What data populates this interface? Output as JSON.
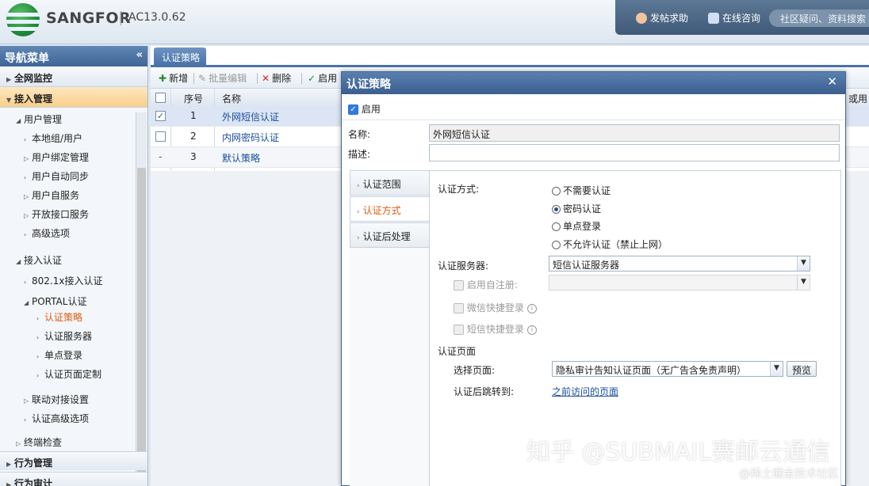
{
  "app": {
    "brand": "SANGFOR",
    "version": "AC13.0.62"
  },
  "topbar": {
    "help_label": "发帖求助",
    "consult_label": "在线咨询",
    "search_placeholder": "社区疑问、资料搜索"
  },
  "sidebar": {
    "title": "导航菜单",
    "collapse_glyph": "«",
    "sections": [
      "全网监控",
      "接入管理"
    ],
    "tree": {
      "user_mgmt": "用户管理",
      "user_items": [
        "本地组/用户",
        "用户绑定管理",
        "用户自动同步",
        "用户自服务",
        "开放接口服务",
        "高级选项"
      ],
      "access_auth": "接入认证",
      "access_items": [
        "802.1x接入认证",
        "PORTAL认证"
      ],
      "portal_items": [
        "认证策略",
        "认证服务器",
        "单点登录",
        "认证页面定制"
      ],
      "more_items": [
        "联动对接设置",
        "认证高级选项",
        "终端检查"
      ]
    },
    "bottom_sections": [
      "行为管理",
      "行为审计"
    ]
  },
  "main": {
    "tab_label": "认证策略",
    "toolbar": {
      "add": "新增",
      "batch_edit": "批量编辑",
      "delete": "删除",
      "enable": "启用"
    },
    "grid": {
      "headers": {
        "index": "序号",
        "name": "名称",
        "right_col": "或用户"
      },
      "rows": [
        {
          "index": "1",
          "name": "外网短信认证",
          "checked": "✓"
        },
        {
          "index": "2",
          "name": "内网密码认证",
          "checked": ""
        },
        {
          "index": "3",
          "name": "默认策略",
          "checked": "-"
        }
      ]
    }
  },
  "modal": {
    "title": "认证策略",
    "close": "✕",
    "enable_label": "启用",
    "name_label": "名称:",
    "name_value": "外网短信认证",
    "desc_label": "描述:",
    "desc_value": "",
    "subnav": [
      "认证范围",
      "认证方式",
      "认证后处理"
    ],
    "auth_method_label": "认证方式:",
    "auth_options": [
      "不需要认证",
      "密码认证",
      "单点登录",
      "不允许认证（禁止上网）"
    ],
    "auth_selected": "密码认证",
    "server_label": "认证服务器:",
    "server_value": "短信认证服务器",
    "self_register_label": "启用自注册:",
    "wechat_label": "微信快捷登录",
    "sms_label": "短信快捷登录",
    "page_section_label": "认证页面",
    "select_page_label": "选择页面:",
    "select_page_value": "隐私审计告知认证页面（无广告含免责声明）",
    "preview_label": "预览",
    "redirect_label": "认证后跳转到:",
    "redirect_value": "之前访问的页面"
  },
  "watermark": {
    "main": "知乎 @SUBMAIL赛邮云通信",
    "sub": "@稀土掘金技术社区"
  },
  "colors": {
    "accent": "#4a73a8",
    "active_orange": "#e05b12",
    "link_blue": "#1a4fa0"
  }
}
